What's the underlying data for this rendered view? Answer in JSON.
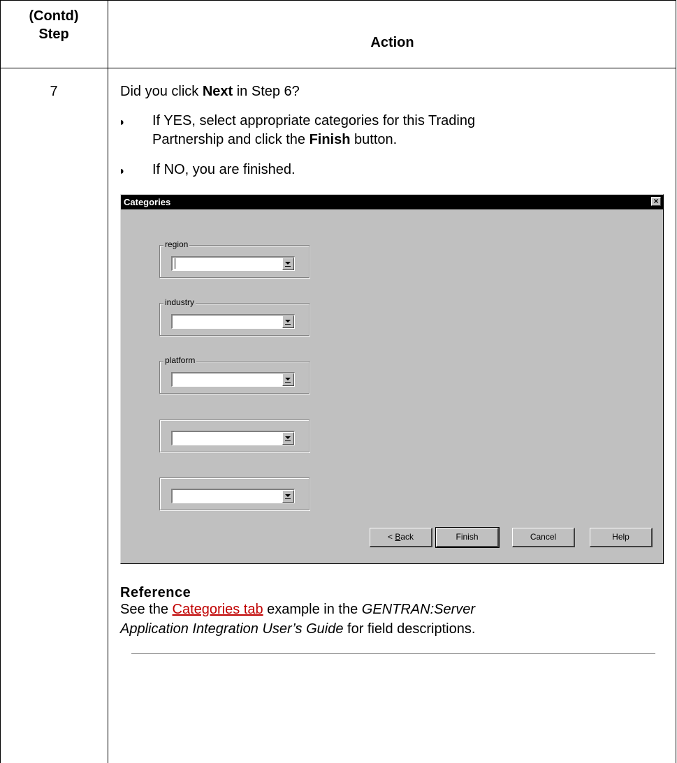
{
  "header": {
    "step_line1": "(Contd)",
    "step_line2": "Step",
    "action": "Action"
  },
  "row": {
    "step_number": "7",
    "question_pre": "Did you click ",
    "question_bold": "Next",
    "question_post": " in Step 6?",
    "bullets": [
      {
        "line1": "If YES, select appropriate categories for this Trading",
        "line2_pre": "Partnership and click the ",
        "line2_bold": "Finish",
        "line2_post": " button."
      },
      {
        "line1": "If NO, you are finished."
      }
    ]
  },
  "dialog": {
    "title": "Categories",
    "close_glyph": "×",
    "groups": [
      {
        "label": "region",
        "value": ""
      },
      {
        "label": "industry",
        "value": ""
      },
      {
        "label": "platform",
        "value": ""
      },
      {
        "label": "",
        "value": ""
      },
      {
        "label": "",
        "value": ""
      }
    ],
    "buttons": {
      "back_pre": "< ",
      "back_underlined": "B",
      "back_post": "ack",
      "finish": "Finish",
      "cancel": "Cancel",
      "help": "Help"
    }
  },
  "reference": {
    "heading": "Reference",
    "line1_pre": "See the ",
    "line1_link": "Categories tab",
    "line1_mid": " example in the ",
    "line1_italic": "GENTRAN:Server",
    "line2_italic": "Application Integration User’s Guide",
    "line2_post": " for field descriptions."
  },
  "colors": {
    "link": "#c00000",
    "dialog_face": "#c0c0c0",
    "title_bar": "#000000"
  }
}
